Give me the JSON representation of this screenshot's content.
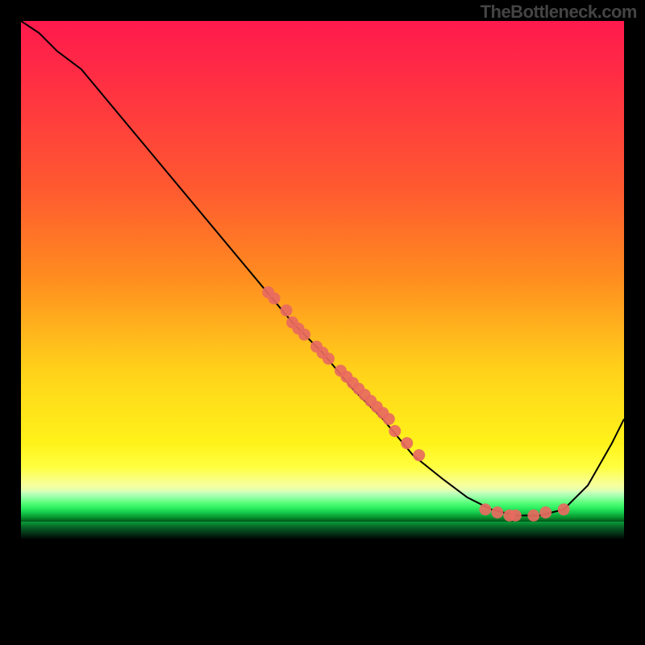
{
  "watermark": "TheBottleneck.com",
  "chart_data": {
    "type": "line",
    "title": "",
    "xlabel": "",
    "ylabel": "",
    "xlim": [
      0,
      100
    ],
    "ylim": [
      0,
      100
    ],
    "legend": false,
    "grid": false,
    "series": [
      {
        "name": "curve",
        "x": [
          0,
          3,
          6,
          10,
          15,
          20,
          25,
          30,
          35,
          40,
          45,
          50,
          55,
          60,
          65,
          70,
          74,
          78,
          82,
          86,
          90,
          94,
          98,
          100
        ],
        "y": [
          100,
          98,
          95,
          92,
          86,
          80,
          74,
          68,
          62,
          56,
          50,
          45,
          39,
          34,
          28,
          24,
          21,
          19,
          18,
          18,
          19,
          23,
          30,
          34
        ]
      }
    ],
    "scatter": {
      "name": "highlighted-points",
      "color": "#e86a60",
      "points": [
        {
          "x": 41,
          "y": 55
        },
        {
          "x": 42,
          "y": 54
        },
        {
          "x": 44,
          "y": 52
        },
        {
          "x": 45,
          "y": 50
        },
        {
          "x": 46,
          "y": 49
        },
        {
          "x": 47,
          "y": 48
        },
        {
          "x": 49,
          "y": 46
        },
        {
          "x": 50,
          "y": 45
        },
        {
          "x": 51,
          "y": 44
        },
        {
          "x": 53,
          "y": 42
        },
        {
          "x": 54,
          "y": 41
        },
        {
          "x": 55,
          "y": 40
        },
        {
          "x": 56,
          "y": 39
        },
        {
          "x": 57,
          "y": 38
        },
        {
          "x": 58,
          "y": 37
        },
        {
          "x": 59,
          "y": 36
        },
        {
          "x": 60,
          "y": 35
        },
        {
          "x": 61,
          "y": 34
        },
        {
          "x": 62,
          "y": 32
        },
        {
          "x": 64,
          "y": 30
        },
        {
          "x": 66,
          "y": 28
        },
        {
          "x": 77,
          "y": 19
        },
        {
          "x": 79,
          "y": 18.5
        },
        {
          "x": 81,
          "y": 18
        },
        {
          "x": 82,
          "y": 18
        },
        {
          "x": 85,
          "y": 18
        },
        {
          "x": 87,
          "y": 18.5
        },
        {
          "x": 90,
          "y": 19
        }
      ]
    }
  }
}
